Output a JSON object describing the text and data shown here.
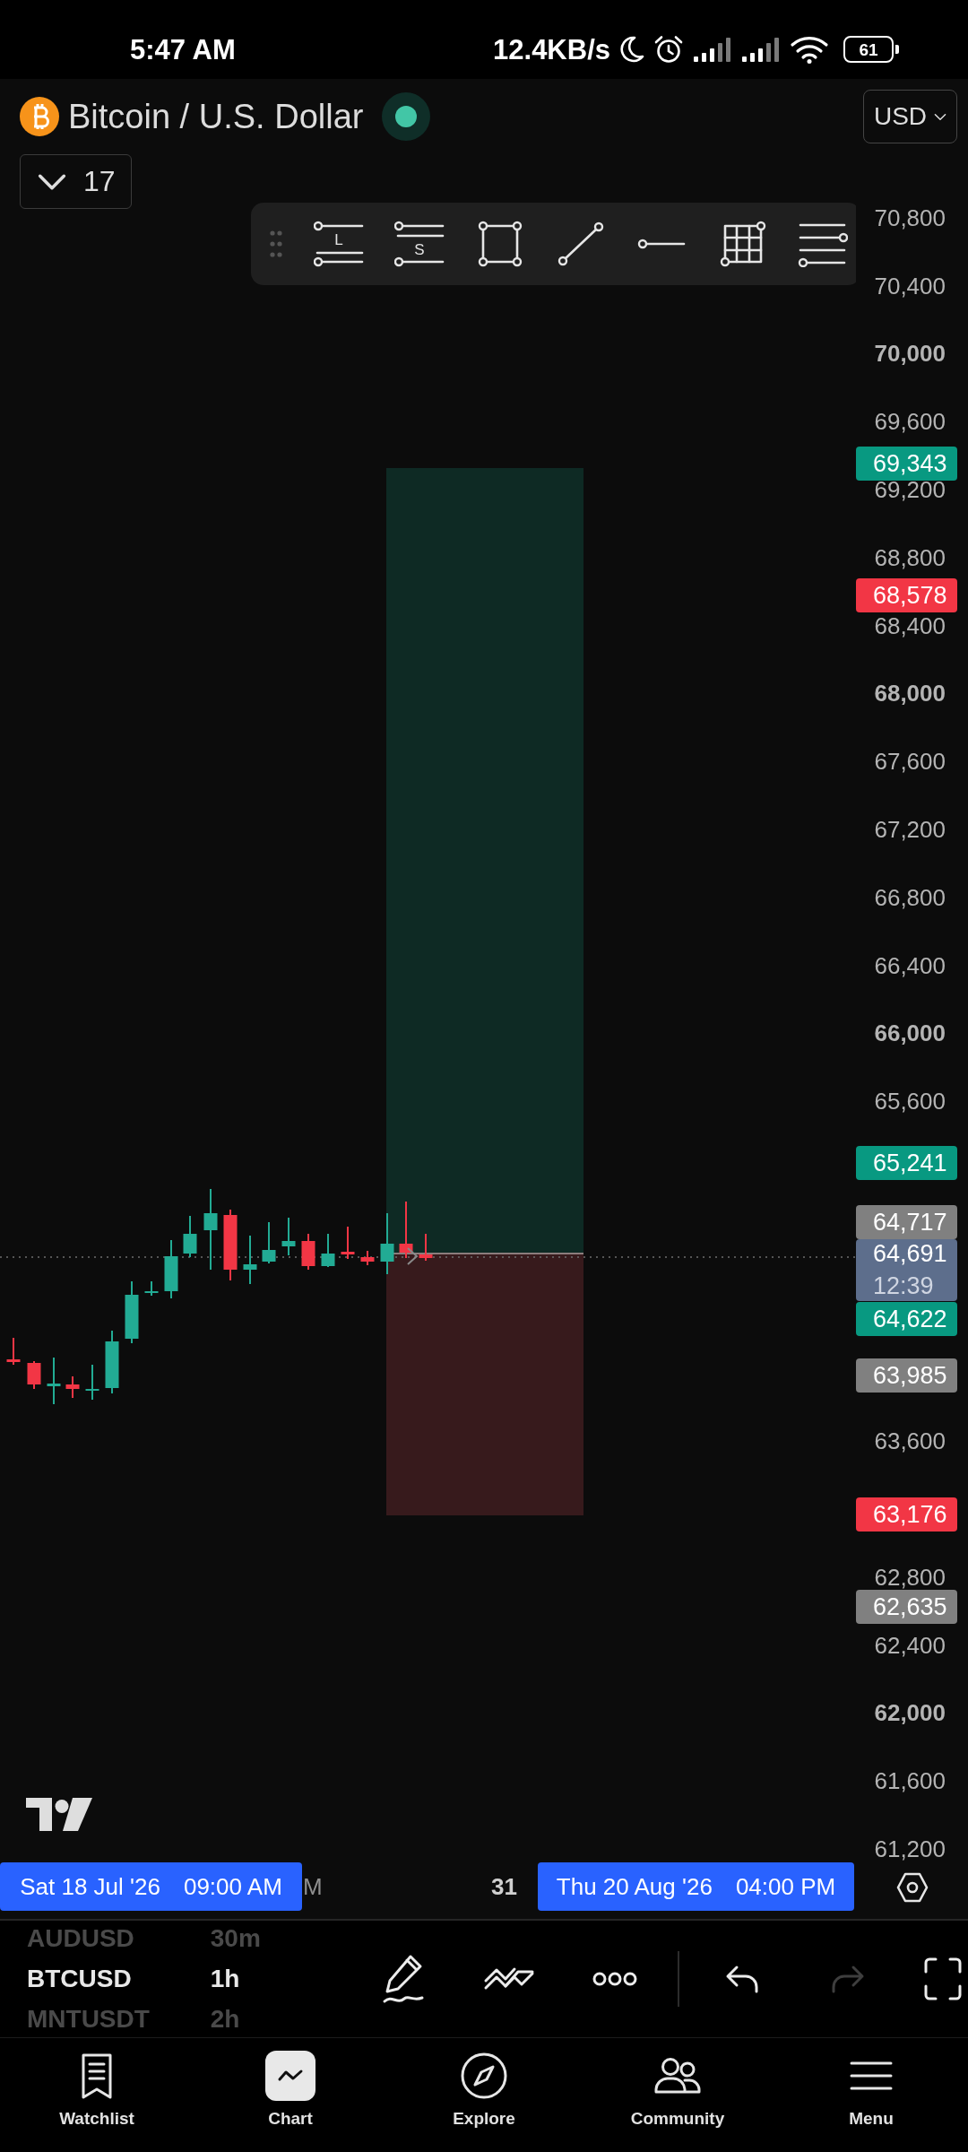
{
  "status_bar": {
    "time": "5:47 AM",
    "network_speed": "12.4KB/s",
    "battery": "61"
  },
  "symbol_header": {
    "title": "Bitcoin / U.S. Dollar",
    "market_open": true,
    "indicator_count": "17",
    "currency": "USD"
  },
  "drawing_toolbar": [
    {
      "kind": "long-position",
      "letter": "L"
    },
    {
      "kind": "short-position",
      "letter": "S"
    },
    {
      "kind": "rectangle"
    },
    {
      "kind": "trend-line"
    },
    {
      "kind": "horizontal-ray"
    },
    {
      "kind": "gann-box"
    },
    {
      "kind": "parallel-channel"
    }
  ],
  "price_scale": {
    "ticks": [
      {
        "label": "70,800",
        "major": false
      },
      {
        "label": "70,400",
        "major": false
      },
      {
        "label": "70,000",
        "major": true
      },
      {
        "label": "69,600",
        "major": false
      },
      {
        "label": "69,200",
        "major": false
      },
      {
        "label": "68,800",
        "major": false
      },
      {
        "label": "68,400",
        "major": false
      },
      {
        "label": "68,000",
        "major": true
      },
      {
        "label": "67,600",
        "major": false
      },
      {
        "label": "67,200",
        "major": false
      },
      {
        "label": "66,800",
        "major": false
      },
      {
        "label": "66,400",
        "major": false
      },
      {
        "label": "66,000",
        "major": true
      },
      {
        "label": "65,600",
        "major": false
      },
      {
        "label": "63,600",
        "major": false
      },
      {
        "label": "62,800",
        "major": false
      },
      {
        "label": "62,400",
        "major": false
      },
      {
        "label": "62,000",
        "major": true
      },
      {
        "label": "61,600",
        "major": false
      },
      {
        "label": "61,200",
        "major": false
      }
    ],
    "badges": [
      {
        "price": "69,343",
        "color": "#089981"
      },
      {
        "price": "68,578",
        "color": "#f23645"
      },
      {
        "price": "65,241",
        "color": "#089981"
      },
      {
        "price": "64,717",
        "color": "#808080"
      },
      {
        "price": "64,691",
        "countdown": "12:39",
        "color": "#5d6e8c"
      },
      {
        "price": "64,622",
        "color": "#089981"
      },
      {
        "price": "63,985",
        "color": "#808080"
      },
      {
        "price": "63,176",
        "color": "#f23645"
      },
      {
        "price": "62,635",
        "color": "#808080"
      }
    ]
  },
  "time_scale": {
    "ticks": [
      {
        "label": "M",
        "major": false
      },
      {
        "label": "31",
        "major": true
      }
    ],
    "range_labels": [
      {
        "date": "Sat 18 Jul '26",
        "time": "09:00 AM"
      },
      {
        "date": "Thu 20 Aug '26",
        "time": "04:00 PM"
      }
    ]
  },
  "symbol_picker": [
    {
      "symbol": "AUDUSD",
      "interval": "30m",
      "selected": false
    },
    {
      "symbol": "BTCUSD",
      "interval": "1h",
      "selected": true
    },
    {
      "symbol": "MNTUSDT",
      "interval": "2h",
      "selected": false
    }
  ],
  "chart_actions": [
    {
      "kind": "brush",
      "disabled": false
    },
    {
      "kind": "multi-select",
      "disabled": false
    },
    {
      "kind": "more",
      "disabled": false
    },
    {
      "kind": "undo",
      "disabled": false
    },
    {
      "kind": "redo",
      "disabled": true
    },
    {
      "kind": "fullscreen",
      "disabled": false
    }
  ],
  "bottom_nav": [
    {
      "kind": "watchlist",
      "label": "Watchlist",
      "selected": false
    },
    {
      "kind": "chart",
      "label": "Chart",
      "selected": true
    },
    {
      "kind": "explore",
      "label": "Explore",
      "selected": false
    },
    {
      "kind": "community",
      "label": "Community",
      "selected": false
    },
    {
      "kind": "menu",
      "label": "Menu",
      "selected": false
    }
  ]
}
